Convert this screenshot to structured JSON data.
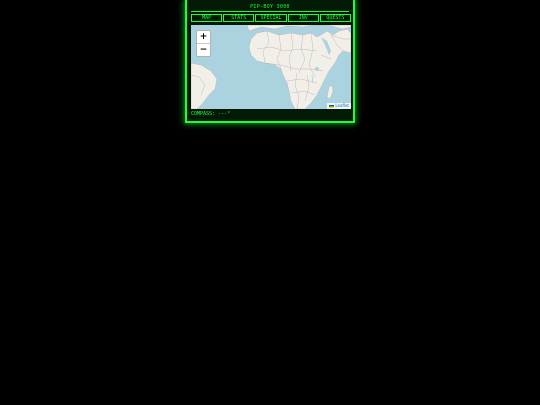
{
  "app": {
    "title": "PIP-BOY 3000"
  },
  "tabs": [
    {
      "label": "MAP"
    },
    {
      "label": "STATS"
    },
    {
      "label": "SPECIAL"
    },
    {
      "label": "INV"
    },
    {
      "label": "QUESTS"
    }
  ],
  "map": {
    "zoom_in_label": "+",
    "zoom_out_label": "−",
    "attribution": "Leaflet",
    "water_color": "#aad3df",
    "land_color": "#f2efe9",
    "border_color": "#b4aab8"
  },
  "compass": {
    "label": "COMPASS:",
    "value": "---°"
  },
  "colors": {
    "accent": "#1aff3a",
    "background": "#000000"
  }
}
